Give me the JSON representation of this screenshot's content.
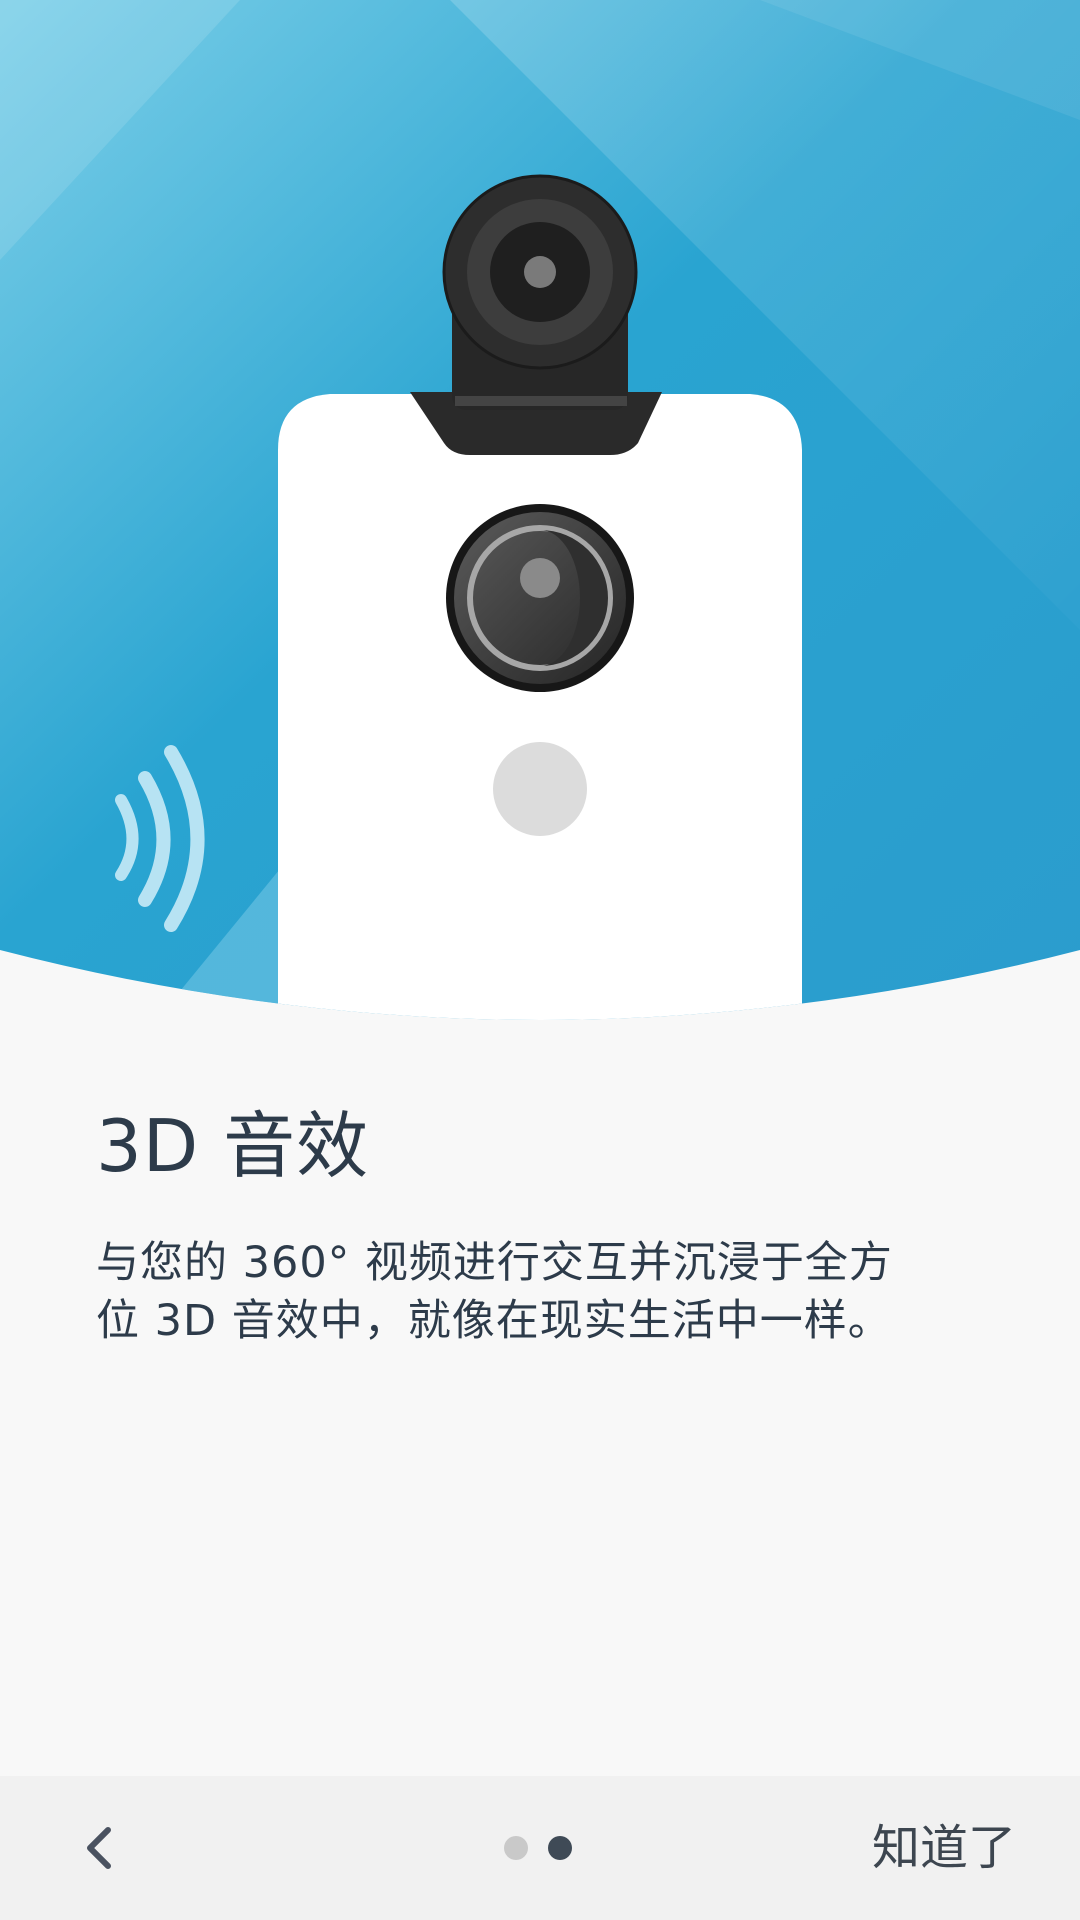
{
  "onboarding": {
    "title": "3D 音效",
    "description_line1": "与您的 360° 视频进行交互并沉浸于全方",
    "description_line2": "位 3D 音效中，就像在现实生活中一样。"
  },
  "navigation": {
    "back_icon": "chevron-left-icon",
    "got_it_label": "知道了",
    "page_indicator": {
      "total": 2,
      "current": 2
    }
  },
  "colors": {
    "background": "#f8f8f8",
    "hero_blue": "#2aa3cf",
    "hero_blue_dark": "#1f93c3",
    "hero_blue_light": "#7fd0ea",
    "text": "#2d3b4a",
    "bottom_bar": "#f1f1f1",
    "dot_inactive": "#c9c9c9",
    "dot_active": "#3f4a56"
  }
}
